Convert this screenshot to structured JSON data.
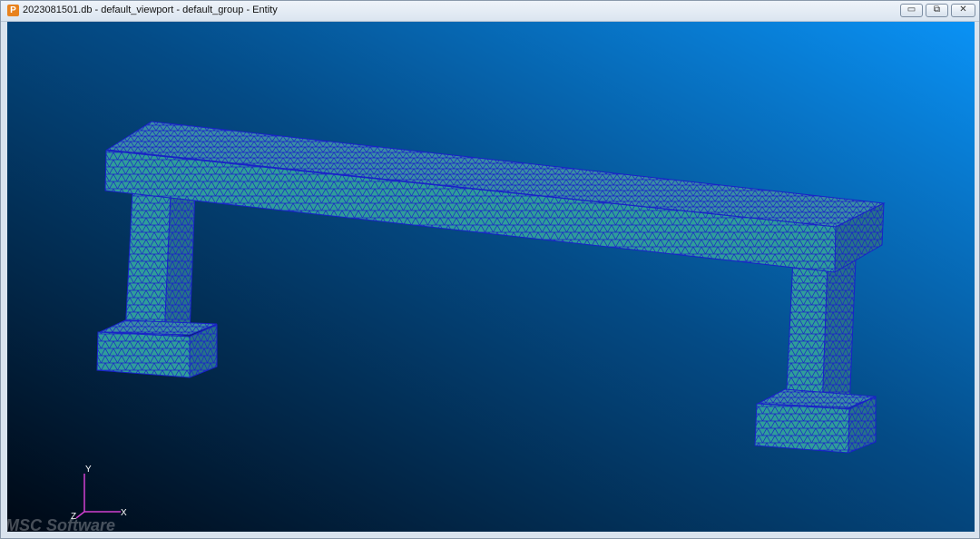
{
  "window": {
    "title": "2023081501.db - default_viewport - default_group - Entity",
    "app_icon_glyph": "P",
    "controls": {
      "minimize": "▭",
      "maximize": "⧉",
      "close": "✕"
    }
  },
  "viewport": {
    "background_top_right": "#0a8ff0",
    "background_bottom_left": "#000510",
    "mesh_fill": "#2f9e9a",
    "mesh_edge": "#1a22c8",
    "axes": {
      "y": "Y",
      "x": "X",
      "z": "Z",
      "color": "#d040d0"
    },
    "watermark": "MSC Software"
  }
}
